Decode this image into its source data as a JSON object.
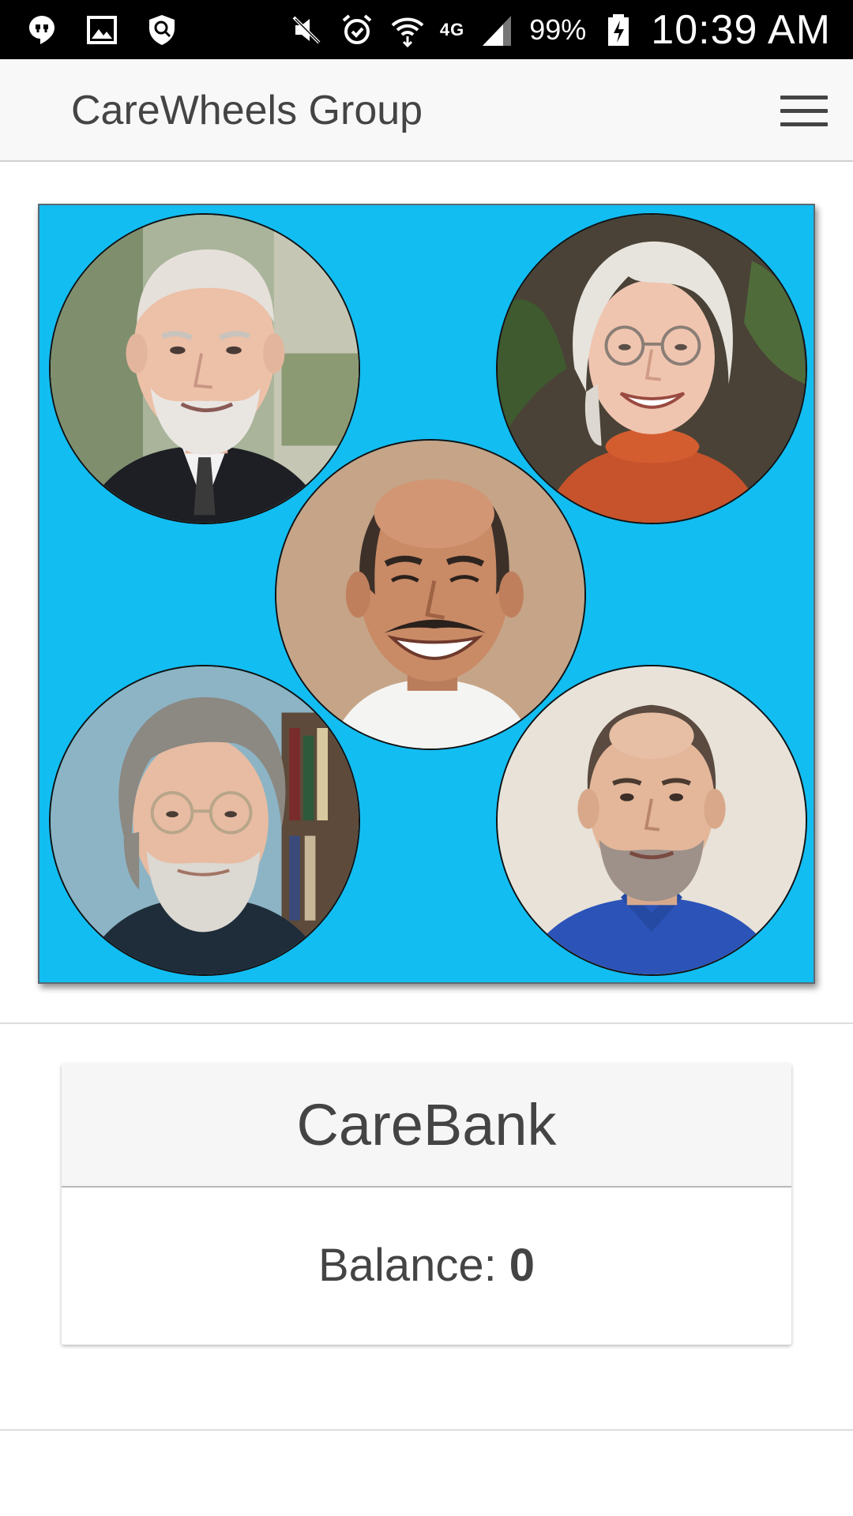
{
  "status_bar": {
    "network_label": "4G",
    "battery_percent": "99%",
    "time": "10:39 AM",
    "icons": [
      "hangouts-icon",
      "gallery-icon",
      "security-icon",
      "mute-icon",
      "alarm-icon",
      "wifi-icon",
      "signal-icon",
      "battery-charging-icon"
    ]
  },
  "header": {
    "title": "CareWheels Group",
    "menu_icon": "hamburger-menu-icon"
  },
  "group": {
    "background_color": "#12bdf2",
    "members": [
      {
        "slot": "top-left",
        "photo": "member-photo-elderly-man-suit"
      },
      {
        "slot": "top-right",
        "photo": "member-photo-woman-white-hair"
      },
      {
        "slot": "center",
        "photo": "member-photo-man-mustache"
      },
      {
        "slot": "bottom-left",
        "photo": "member-photo-man-glasses-beard"
      },
      {
        "slot": "bottom-right",
        "photo": "member-photo-man-blue-shirt"
      }
    ]
  },
  "carebank": {
    "title": "CareBank",
    "balance_label": "Balance:",
    "balance_value": "0"
  }
}
